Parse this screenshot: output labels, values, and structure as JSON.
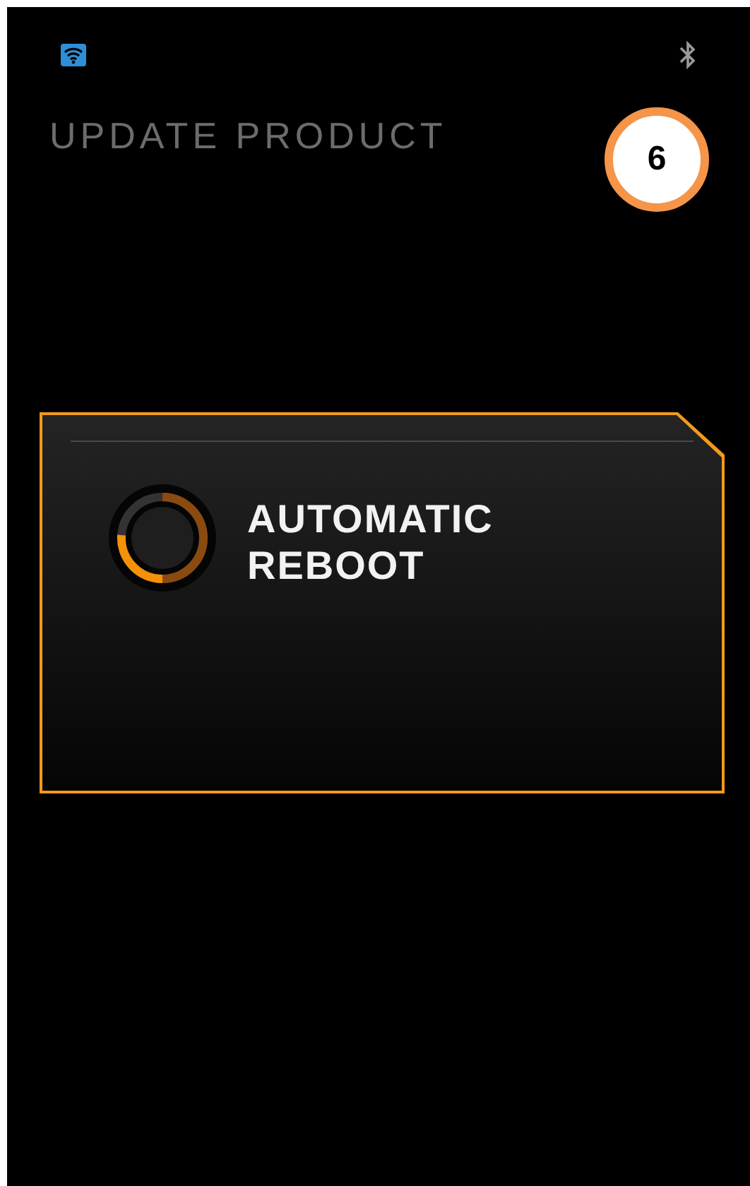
{
  "screen_title": "UPDATE PRODUCT",
  "step_badge": "6",
  "dialog": {
    "message": "AUTOMATIC REBOOT"
  }
}
